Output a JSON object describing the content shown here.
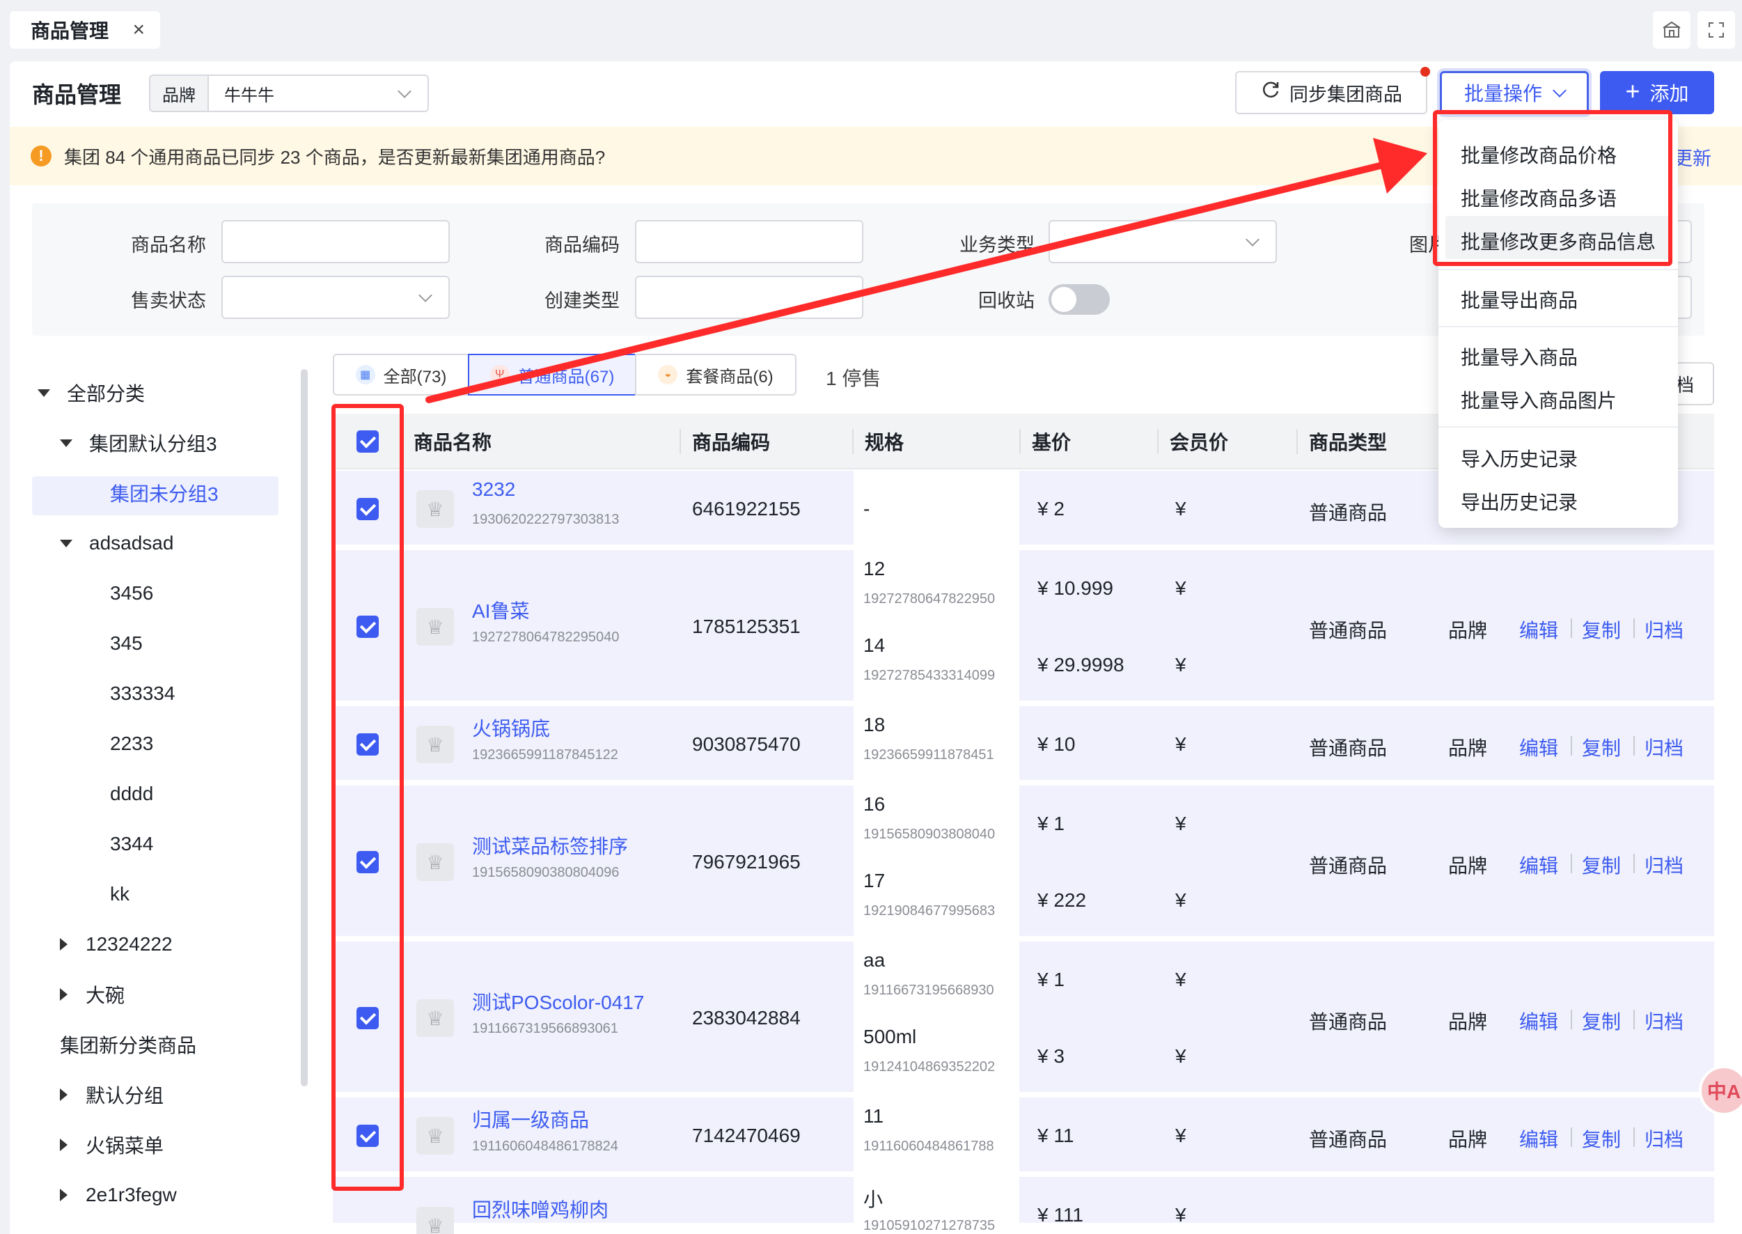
{
  "tab": {
    "title": "商品管理",
    "close": "×"
  },
  "header": {
    "title": "商品管理",
    "brand_label": "品牌",
    "brand_value": "牛牛牛",
    "sync_label": "同步集团商品",
    "batch_label": "批量操作",
    "add_label": "添加"
  },
  "notice": {
    "text": "集团 84 个通用商品已同步 23 个商品，是否更新最新集团通用商品?",
    "link": "更新"
  },
  "filters": {
    "name_label": "商品名称",
    "code_label": "商品编码",
    "biz_label": "业务类型",
    "img_label": "图片",
    "sale_label": "售卖状态",
    "create_label": "创建类型",
    "recycle_label": "回收站"
  },
  "tree": [
    {
      "label": "全部分类",
      "level": 0,
      "caret": "down"
    },
    {
      "label": "集团默认分组3",
      "level": 1,
      "caret": "down"
    },
    {
      "label": "集团未分组3",
      "level": 2,
      "caret": "none",
      "selected": true
    },
    {
      "label": "adsadsad",
      "level": 1,
      "caret": "down"
    },
    {
      "label": "3456",
      "level": 2,
      "caret": "none"
    },
    {
      "label": "345",
      "level": 2,
      "caret": "none"
    },
    {
      "label": "333334",
      "level": 2,
      "caret": "none"
    },
    {
      "label": "2233",
      "level": 2,
      "caret": "none"
    },
    {
      "label": "dddd",
      "level": 2,
      "caret": "none"
    },
    {
      "label": "3344",
      "level": 2,
      "caret": "none"
    },
    {
      "label": "kk",
      "level": 2,
      "caret": "none"
    },
    {
      "label": "12324222",
      "level": 1,
      "caret": "right"
    },
    {
      "label": "大碗",
      "level": 1,
      "caret": "right"
    },
    {
      "label": "集团新分类商品",
      "level": 1,
      "caret": "none"
    },
    {
      "label": "默认分组",
      "level": 1,
      "caret": "right"
    },
    {
      "label": "火锅菜单",
      "level": 1,
      "caret": "right"
    },
    {
      "label": "2e1r3fegw",
      "level": 1,
      "caret": "right"
    }
  ],
  "cat_tabs": {
    "all": "全部(73)",
    "normal": "普通商品(67)",
    "combo": "套餐商品(6)",
    "stopped": "1 停售",
    "right_btn": "档"
  },
  "table": {
    "columns": [
      "商品名称",
      "商品编码",
      "规格",
      "基价",
      "会员价",
      "商品类型"
    ],
    "actions": {
      "brand": "品牌",
      "edit": "编辑",
      "copy": "复制",
      "archive": "归档"
    },
    "rows": [
      {
        "name": "3232",
        "id": "1930620222797303813",
        "code": "6461922155",
        "type": "普通商品",
        "specs": [
          {
            "spec": "-",
            "sub": "",
            "price": "¥ 2",
            "member": "¥"
          }
        ]
      },
      {
        "name": "AI鲁菜",
        "id": "1927278064782295040",
        "code": "1785125351",
        "type": "普通商品",
        "specs": [
          {
            "spec": "12",
            "sub": "19272780647822950",
            "price": "¥ 10.999",
            "member": "¥"
          },
          {
            "spec": "14",
            "sub": "19272785433314099",
            "price": "¥ 29.9998",
            "member": "¥"
          }
        ]
      },
      {
        "name": "火锅锅底",
        "id": "1923665991187845122",
        "code": "9030875470",
        "type": "普通商品",
        "specs": [
          {
            "spec": "18",
            "sub": "19236659911878451",
            "price": "¥ 10",
            "member": "¥"
          }
        ]
      },
      {
        "name": "测试菜品标签排序",
        "id": "1915658090380804096",
        "code": "7967921965",
        "type": "普通商品",
        "specs": [
          {
            "spec": "16",
            "sub": "19156580903808040",
            "price": "¥ 1",
            "member": "¥"
          },
          {
            "spec": "17",
            "sub": "19219084677995683",
            "price": "¥ 222",
            "member": "¥"
          }
        ]
      },
      {
        "name": "测试POScolor-0417",
        "id": "1911667319566893061",
        "code": "2383042884",
        "type": "普通商品",
        "specs": [
          {
            "spec": "aa",
            "sub": "19116673195668930",
            "price": "¥ 1",
            "member": "¥"
          },
          {
            "spec": "500ml",
            "sub": "19124104869352202",
            "price": "¥ 3",
            "member": "¥"
          }
        ]
      },
      {
        "name": "归属一级商品",
        "id": "1911606048486178824",
        "code": "7142470469",
        "type": "普通商品",
        "specs": [
          {
            "spec": "11",
            "sub": "19116060484861788",
            "price": "¥ 11",
            "member": "¥"
          }
        ]
      },
      {
        "name": "回烈味噌鸡柳肉",
        "id": "",
        "code": "",
        "type": "",
        "specs": [
          {
            "spec": "小",
            "sub": "19105910271278735",
            "price": "¥ 111",
            "member": "¥"
          }
        ]
      }
    ]
  },
  "dropdown": {
    "items": [
      "批量修改商品价格",
      "批量修改商品多语",
      "批量修改更多商品信息",
      "批量导出商品",
      "批量导入商品",
      "批量导入商品图片",
      "导入历史记录",
      "导出历史记录"
    ]
  },
  "float_btn": "中A",
  "colors": {
    "accent": "#3d5bf0",
    "annotation": "#ff2a2a",
    "notice_bg": "#fff8e5",
    "row_selected": "#f0f1fc"
  }
}
